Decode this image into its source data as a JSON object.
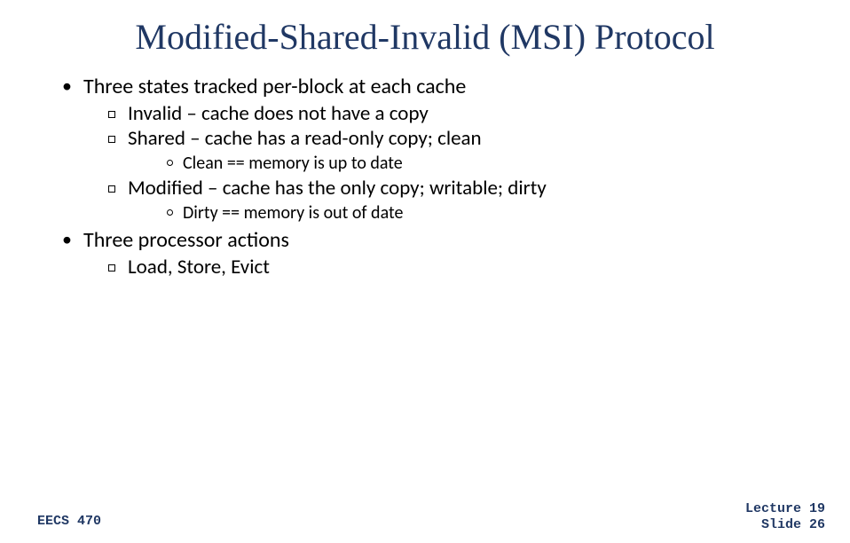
{
  "title": "Modified-Shared-Invalid (MSI) Protocol",
  "bullets": {
    "b1_1": "Three states tracked per-block at each cache",
    "b2_1": "Invalid – cache does not have a copy",
    "b2_2": "Shared – cache has a read-only copy; clean",
    "b3_1": "Clean == memory is up to date",
    "b2_3": "Modified – cache has the only copy; writable; dirty",
    "b3_2": "Dirty == memory is out of date",
    "b1_2": "Three processor actions",
    "b2_4": "Load, Store, Evict"
  },
  "footer": {
    "left": "EECS 470",
    "right_line1": "Lecture 19",
    "right_line2": "Slide 26"
  }
}
